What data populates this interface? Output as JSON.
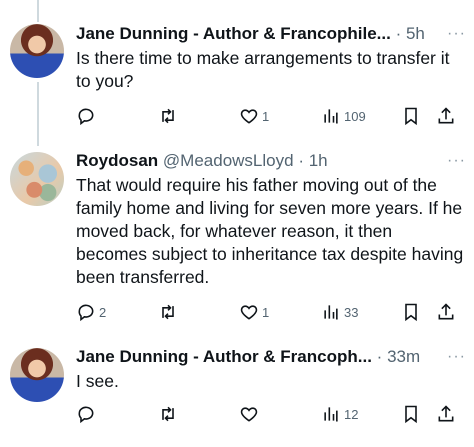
{
  "tweets": [
    {
      "name": "Jane Dunning - Author & Francophile...",
      "handle": "",
      "dot": "·",
      "time": "5h",
      "more": "···",
      "text": "Is there time to make arrangements to transfer it to you?",
      "replies": "",
      "likes": "1",
      "views": "109",
      "reposts": ""
    },
    {
      "name": "Roydosan",
      "handle": "@MeadowsLloyd",
      "dot": "·",
      "time": "1h",
      "more": "···",
      "text": "That would require his father moving out of the family home and living for seven more years. If he moved back, for whatever reason, it then becomes subject to inheritance tax despite having been transferred.",
      "replies": "2",
      "likes": "1",
      "views": "33",
      "reposts": ""
    },
    {
      "name": "Jane Dunning - Author & Francoph...",
      "handle": "",
      "dot": "·",
      "time": "33m",
      "more": "···",
      "text": "I see.",
      "replies": "",
      "likes": "",
      "views": "12",
      "reposts": ""
    }
  ],
  "icons": {
    "reply": "reply-icon",
    "repost": "repost-icon",
    "like": "like-icon",
    "views": "views-icon",
    "bookmark": "bookmark-icon",
    "share": "share-icon"
  }
}
